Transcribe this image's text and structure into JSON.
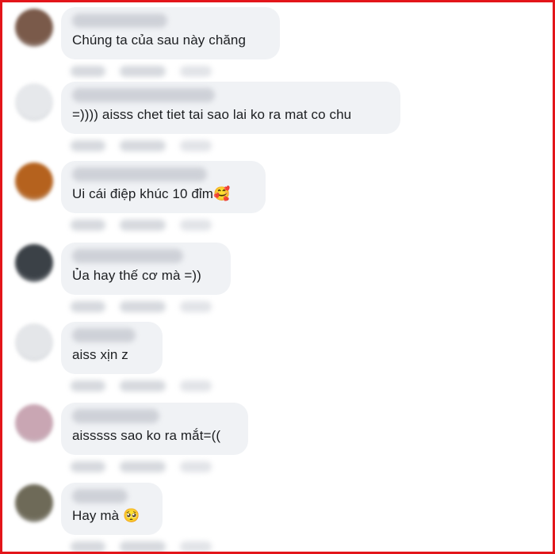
{
  "comments": [
    {
      "text": "Chúng ta của sau này chăng",
      "emoji": "",
      "avatar_color": "#7a5a4a"
    },
    {
      "text": "=)))) aisss chet tiet tai sao lai ko ra mat co chu",
      "emoji": "",
      "avatar_color": "#e6e8eb"
    },
    {
      "text": "Ui cái điệp khúc 10 đỉm",
      "emoji": "🥰",
      "avatar_color": "#b5621e"
    },
    {
      "text": "Ủa hay thế cơ mà =))",
      "emoji": "",
      "avatar_color": "#3b4147"
    },
    {
      "text": "aiss xịn z",
      "emoji": "",
      "avatar_color": "#e4e6e9"
    },
    {
      "text": "aisssss sao ko ra mắt=((",
      "emoji": "",
      "avatar_color": "#c9a6b3"
    },
    {
      "text": "Hay mà ",
      "emoji": "🥺",
      "avatar_color": "#6e6a58"
    }
  ],
  "colors": {
    "frame_border": "#e3151a",
    "bubble_background": "#f0f2f5",
    "text": "#1c1e21"
  }
}
